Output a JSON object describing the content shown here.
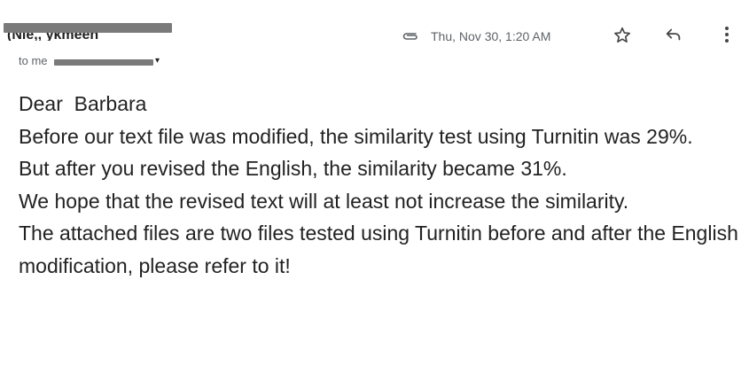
{
  "header": {
    "sender_name": "(Nie,, ykmeen",
    "recipients_prefix": "to me",
    "recipients_caret": "▾",
    "attachment_icon": "paperclip-icon",
    "date": "Thu, Nov 30, 1:20 AM"
  },
  "actions": {
    "star_icon": "star-icon",
    "reply_icon": "reply-icon",
    "more_icon": "more-vertical-icon"
  },
  "email": {
    "greeting": "Dear  Barbara",
    "paragraphs": [
      "Before our text file was modified, the similarity test using Turnitin was 29%.",
      "But after you revised the English, the similarity became 31%.",
      "We hope that the revised text will at least not increase the similarity.",
      "The attached files are two files tested using Turnitin before and after the English modification, please refer to it!"
    ]
  }
}
